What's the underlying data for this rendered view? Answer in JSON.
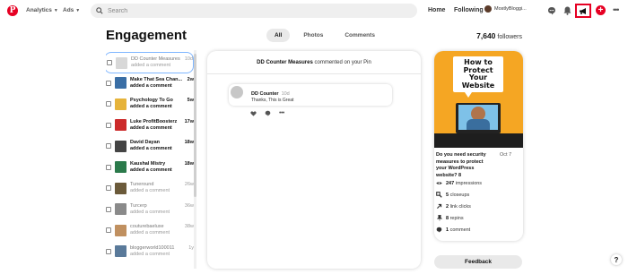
{
  "topbar": {
    "logo_icon": "pinterest-logo",
    "analytics_label": "Analytics",
    "ads_label": "Ads",
    "search_placeholder": "Search",
    "home_label": "Home",
    "following_label": "Following",
    "profile_name": "MostlyBloggi..."
  },
  "page": {
    "title": "Engagement",
    "tabs": [
      {
        "label": "All",
        "active": true
      },
      {
        "label": "Photos",
        "active": false
      },
      {
        "label": "Comments",
        "active": false
      }
    ],
    "followers_count": "7,640",
    "followers_label": "followers"
  },
  "notifications": [
    {
      "name": "DD Counter Measures",
      "action": "added a comment",
      "time": "10d",
      "read": true,
      "selected": true,
      "thumb_color": "#d8d8d8"
    },
    {
      "name": "Make That Sea Chan...",
      "action": "added a comment",
      "time": "2w",
      "read": false,
      "selected": false,
      "thumb_color": "#3a6ea5"
    },
    {
      "name": "Psychology To Go",
      "action": "added a comment",
      "time": "5w",
      "read": false,
      "selected": false,
      "thumb_color": "#e6b33a"
    },
    {
      "name": "Luke ProfitBoosterz",
      "action": "added a comment",
      "time": "17w",
      "read": false,
      "selected": false,
      "thumb_color": "#cc2a2a"
    },
    {
      "name": "David Dayan",
      "action": "added a comment",
      "time": "18w",
      "read": false,
      "selected": false,
      "thumb_color": "#444444"
    },
    {
      "name": "Kaushal Mistry",
      "action": "added a comment",
      "time": "18w",
      "read": false,
      "selected": false,
      "thumb_color": "#2b7a4b"
    },
    {
      "name": "Tuneround",
      "action": "added a comment",
      "time": "26w",
      "read": true,
      "selected": false,
      "thumb_color": "#6b5a3a"
    },
    {
      "name": "Turcerp",
      "action": "added a comment",
      "time": "36w",
      "read": true,
      "selected": false,
      "thumb_color": "#8a8a8a"
    },
    {
      "name": "couturebaeluxe",
      "action": "added a comment",
      "time": "38w",
      "read": true,
      "selected": false,
      "thumb_color": "#c09060"
    },
    {
      "name": "bloggerworld100011",
      "action": "added a comment",
      "time": "1y",
      "read": true,
      "selected": false,
      "thumb_color": "#5a7a9a"
    }
  ],
  "detail": {
    "author": "DD Counter Measures",
    "header_rest": "commented on your Pin",
    "comment_author": "DD Counter",
    "comment_time": "10d",
    "comment_text": "Thanks, This is Great"
  },
  "pin": {
    "image_text_line1": "How to",
    "image_text_line2": "Protect",
    "image_text_line3": "Your",
    "image_text_line4": "Website",
    "title": "Do you need security measures to protect your WordPress website? 8",
    "date": "Oct 7",
    "stats": [
      {
        "icon": "eye-icon",
        "value": "247",
        "label": "impressions"
      },
      {
        "icon": "closeup-icon",
        "value": "5",
        "label": "closeups"
      },
      {
        "icon": "link-icon",
        "value": "2",
        "label": "link clicks"
      },
      {
        "icon": "pin-icon",
        "value": "8",
        "label": "repins"
      },
      {
        "icon": "comment-icon",
        "value": "1",
        "label": "comment"
      }
    ]
  },
  "footer": {
    "feedback_label": "Feedback",
    "help_label": "?"
  },
  "colors": {
    "brand": "#e60023",
    "selected_outline": "#7fb6ff"
  }
}
